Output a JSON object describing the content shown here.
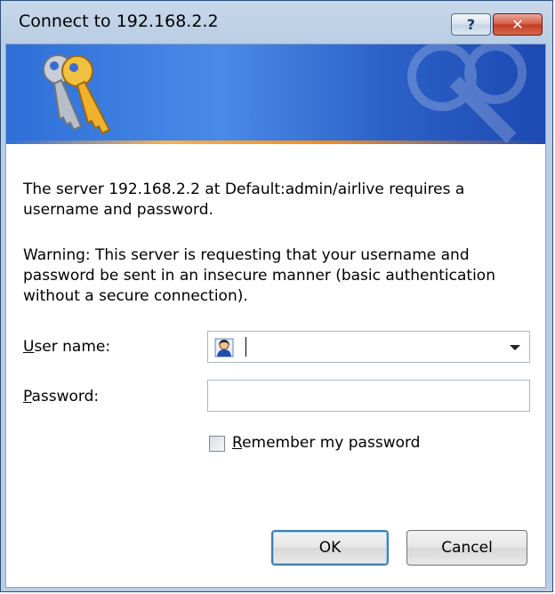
{
  "window": {
    "title": "Connect to 192.168.2.2",
    "help_button": "?",
    "close_button": "✕"
  },
  "message": {
    "server_info": "The server 192.168.2.2 at Default:admin/airlive requires a username and password.",
    "warning": "Warning: This server is requesting that your username and password be sent in an insecure manner (basic authentication without a secure connection)."
  },
  "form": {
    "username_label_accel": "U",
    "username_label_rest": "ser name:",
    "username_value": "",
    "password_label_accel": "P",
    "password_label_rest": "assword:",
    "password_value": "",
    "remember_accel": "R",
    "remember_rest": "emember my password",
    "remember_checked": false
  },
  "buttons": {
    "ok": "OK",
    "cancel": "Cancel"
  },
  "colors": {
    "banner": "#2e6fd8",
    "accent_line": "#f08a20",
    "close_red": "#c43c23"
  }
}
